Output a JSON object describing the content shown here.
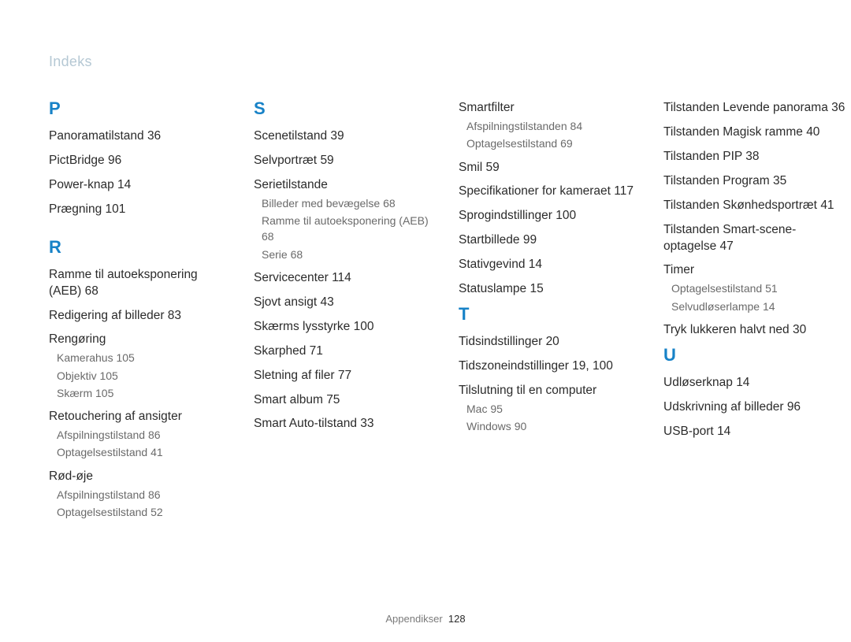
{
  "header": "Indeks",
  "footer_label": "Appendikser",
  "footer_page": "128",
  "col1": {
    "letterP": "P",
    "p_panoramatilstand": "Panoramatilstand",
    "p_panoramatilstand_pg": "36",
    "p_pictbridge": "PictBridge",
    "p_pictbridge_pg": "96",
    "p_powerknap": "Power-knap",
    "p_powerknap_pg": "14",
    "p_praegning": "Prægning",
    "p_praegning_pg": "101",
    "letterR": "R",
    "r_aeb": "Ramme til autoeksponering (AEB)",
    "r_aeb_pg": "68",
    "r_redigering": "Redigering af billeder",
    "r_redigering_pg": "83",
    "r_rengoring": "Rengøring",
    "r_rengoring_s1": "Kamerahus",
    "r_rengoring_s1_pg": "105",
    "r_rengoring_s2": "Objektiv",
    "r_rengoring_s2_pg": "105",
    "r_rengoring_s3": "Skærm",
    "r_rengoring_s3_pg": "105",
    "r_retouch": "Retouchering af ansigter",
    "r_retouch_s1": "Afspilningstilstand",
    "r_retouch_s1_pg": "86",
    "r_retouch_s2": "Optagelsestilstand",
    "r_retouch_s2_pg": "41",
    "r_rodoje": "Rød-øje",
    "r_rodoje_s1": "Afspilningstilstand",
    "r_rodoje_s1_pg": "86",
    "r_rodoje_s2": "Optagelsestilstand",
    "r_rodoje_s2_pg": "52"
  },
  "col2": {
    "letterS": "S",
    "s_scenetilstand": "Scenetilstand",
    "s_scenetilstand_pg": "39",
    "s_selvportraet": "Selvportræt",
    "s_selvportraet_pg": "59",
    "s_serietilstande": "Serietilstande",
    "s_serie_s1": "Billeder med bevægelse",
    "s_serie_s1_pg": "68",
    "s_serie_s2": "Ramme til autoeksponering (AEB)",
    "s_serie_s2_pg": "68",
    "s_serie_s3": "Serie",
    "s_serie_s3_pg": "68",
    "s_servicecenter": "Servicecenter",
    "s_servicecenter_pg": "114",
    "s_sjovt": "Sjovt ansigt",
    "s_sjovt_pg": "43",
    "s_lysstyrke": "Skærms lysstyrke",
    "s_lysstyrke_pg": "100",
    "s_skarphed": "Skarphed",
    "s_skarphed_pg": "71",
    "s_sletning": "Sletning af filer",
    "s_sletning_pg": "77",
    "s_smartalbum": "Smart album",
    "s_smartalbum_pg": "75",
    "s_smartauto": "Smart Auto-tilstand",
    "s_smartauto_pg": "33"
  },
  "col3": {
    "smartfilter": "Smartfilter",
    "sf_s1": "Afspilningstilstanden",
    "sf_s1_pg": "84",
    "sf_s2": "Optagelsestilstand",
    "sf_s2_pg": "69",
    "smil": "Smil",
    "smil_pg": "59",
    "spec": "Specifikationer for kameraet",
    "spec_pg": "117",
    "sprog": "Sprogindstillinger",
    "sprog_pg": "100",
    "startbillede": "Startbillede",
    "startbillede_pg": "99",
    "stativ": "Stativgevind",
    "stativ_pg": "14",
    "statuslampe": "Statuslampe",
    "statuslampe_pg": "15",
    "letterT": "T",
    "t_tids": "Tidsindstillinger",
    "t_tids_pg": "20",
    "t_zone": "Tidszoneindstillinger",
    "t_zone_pg": "19, 100",
    "t_tilslutning": "Tilslutning til en computer",
    "t_tilslutning_s1": "Mac",
    "t_tilslutning_s1_pg": "95",
    "t_tilslutning_s2": "Windows",
    "t_tilslutning_s2_pg": "90"
  },
  "col4": {
    "lev_panorama": "Tilstanden Levende panorama",
    "lev_panorama_pg": "36",
    "magisk": "Tilstanden Magisk ramme",
    "magisk_pg": "40",
    "pip": "Tilstanden PIP",
    "pip_pg": "38",
    "program": "Tilstanden Program",
    "program_pg": "35",
    "skonheds": "Tilstanden Skønhedsportræt",
    "skonheds_pg": "41",
    "smartscene": "Tilstanden Smart-scene-optagelse",
    "smartscene_pg": "47",
    "timer": "Timer",
    "timer_s1": "Optagelsestilstand",
    "timer_s1_pg": "51",
    "timer_s2": "Selvudløserlampe",
    "timer_s2_pg": "14",
    "tryk": "Tryk lukkeren halvt ned",
    "tryk_pg": "30",
    "letterU": "U",
    "u_udloser": "Udløserknap",
    "u_udloser_pg": "14",
    "u_udskrivning": "Udskrivning af billeder",
    "u_udskrivning_pg": "96",
    "u_usb": "USB-port",
    "u_usb_pg": "14"
  }
}
